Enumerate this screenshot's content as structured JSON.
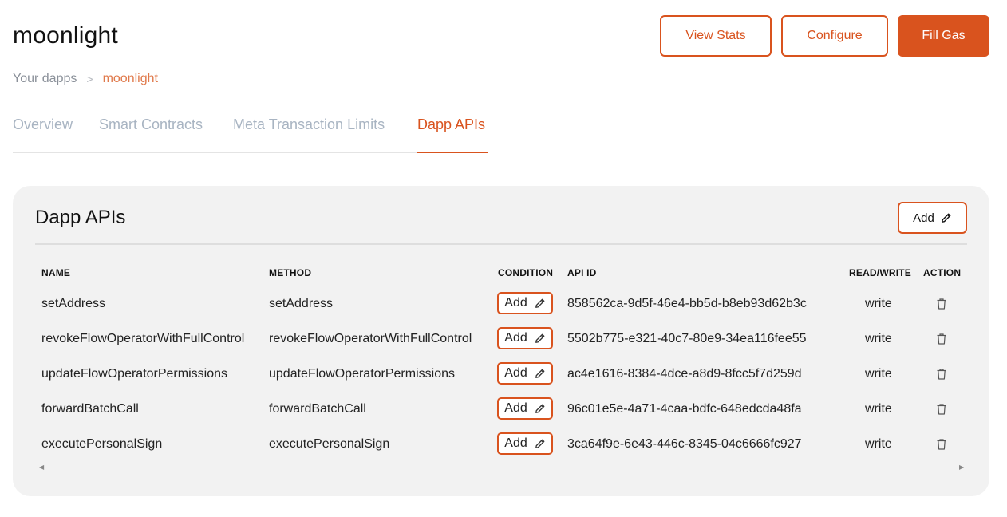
{
  "header": {
    "title": "moonlight",
    "buttons": {
      "view_stats": "View Stats",
      "configure": "Configure",
      "fill_gas": "Fill Gas"
    }
  },
  "breadcrumb": {
    "root": "Your dapps",
    "separator": ">",
    "current": "moonlight"
  },
  "tabs": [
    {
      "label": "Overview",
      "active": false
    },
    {
      "label": "Smart Contracts",
      "active": false
    },
    {
      "label": "Meta Transaction Limits",
      "active": false
    },
    {
      "label": "Dapp APIs",
      "active": true
    }
  ],
  "panel": {
    "title": "Dapp APIs",
    "add_label": "Add",
    "columns": {
      "name": "NAME",
      "method": "METHOD",
      "condition": "CONDITION",
      "api_id": "API ID",
      "read_write": "READ/WRITE",
      "action": "ACTION"
    },
    "condition_add_label": "Add",
    "rows": [
      {
        "name": "setAddress",
        "method": "setAddress",
        "api_id": "858562ca-9d5f-46e4-bb5d-b8eb93d62b3c",
        "read_write": "write"
      },
      {
        "name": "revokeFlowOperatorWithFullControl",
        "method": "revokeFlowOperatorWithFullControl",
        "api_id": "5502b775-e321-40c7-80e9-34ea116fee55",
        "read_write": "write"
      },
      {
        "name": "updateFlowOperatorPermissions",
        "method": "updateFlowOperatorPermissions",
        "api_id": "ac4e1616-8384-4dce-a8d9-8fcc5f7d259d",
        "read_write": "write"
      },
      {
        "name": "forwardBatchCall",
        "method": "forwardBatchCall",
        "api_id": "96c01e5e-4a71-4caa-bdfc-648edcda48fa",
        "read_write": "write"
      },
      {
        "name": "executePersonalSign",
        "method": "executePersonalSign",
        "api_id": "3ca64f9e-6e43-446c-8345-04c6666fc927",
        "read_write": "write"
      }
    ]
  },
  "colors": {
    "accent": "#d9531e",
    "breadcrumb_current": "#e07a4c",
    "tab_inactive": "#a8b4c2",
    "panel_bg": "#f2f2f2"
  },
  "icons": {
    "edit": "pencil-icon",
    "delete": "trash-icon",
    "scroll_left": "scroll-left-arrow-icon",
    "scroll_right": "scroll-right-arrow-icon"
  }
}
